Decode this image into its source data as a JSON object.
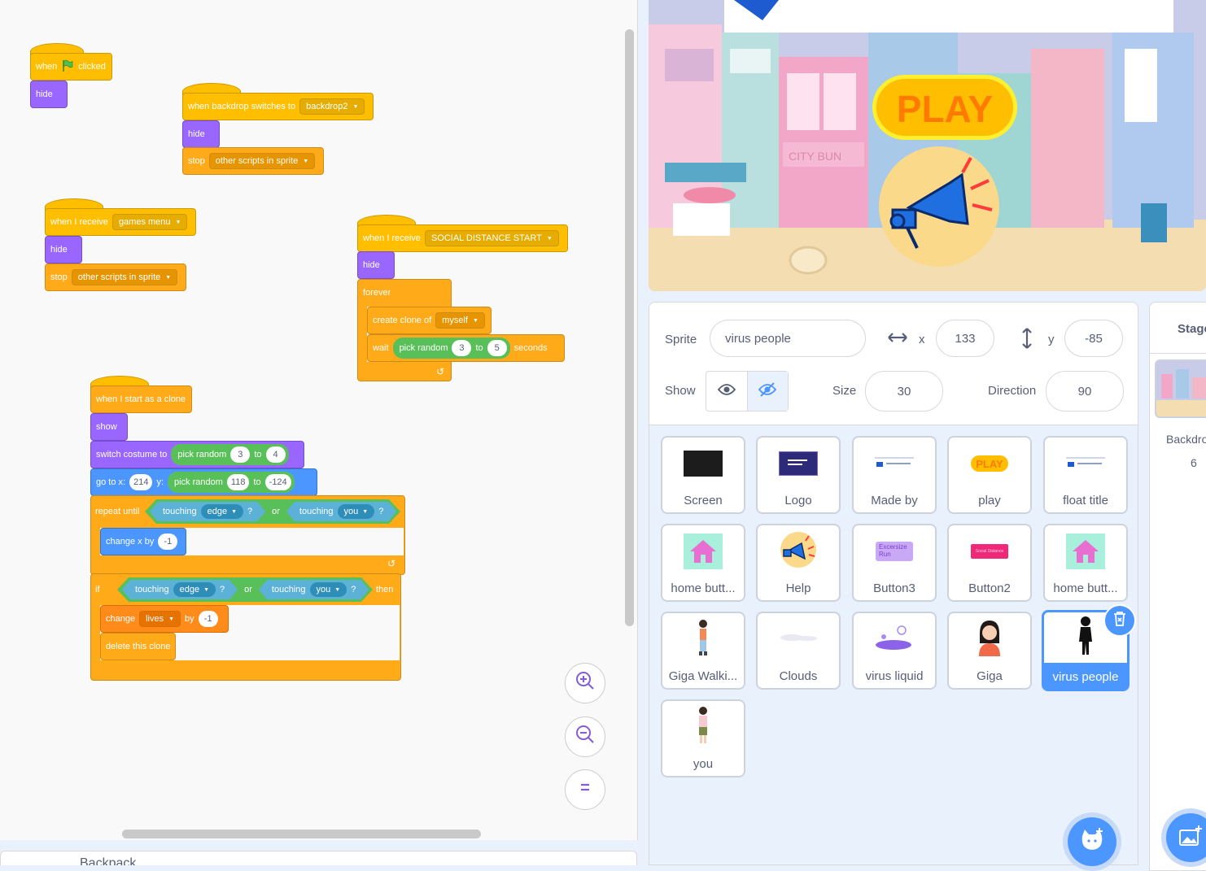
{
  "workspace": {
    "script1": {
      "when": "when",
      "clicked": "clicked",
      "hide": "hide"
    },
    "script2": {
      "label": "when backdrop switches to",
      "backdrop": "backdrop2",
      "hide": "hide",
      "stop": "stop",
      "stop_opt": "other scripts in sprite"
    },
    "script3": {
      "label": "when I receive",
      "msg": "games menu",
      "hide": "hide",
      "stop": "stop",
      "stop_opt": "other scripts in sprite"
    },
    "script4": {
      "label": "when I receive",
      "msg": "SOCIAL DISTANCE START",
      "hide": "hide",
      "forever": "forever",
      "create_clone": "create clone of",
      "clone_opt": "myself",
      "wait": "wait",
      "pick_random": "pick random",
      "from": "3",
      "to_label": "to",
      "to": "5",
      "seconds": "seconds"
    },
    "script5": {
      "label": "when I start as a clone",
      "show": "show",
      "switch_costume": "switch costume to",
      "pick_random": "pick random",
      "c_from": "3",
      "to_label": "to",
      "c_to": "4",
      "goto": "go to x:",
      "goto_x": "214",
      "y_label": "y:",
      "y_from": "118",
      "y_to": "-124",
      "repeat_until": "repeat until",
      "touching": "touching",
      "edge": "edge",
      "q": "?",
      "or": "or",
      "you": "you",
      "change_x": "change x by",
      "change_x_val": "-1",
      "if": "if",
      "then": "then",
      "change": "change",
      "lives": "lives",
      "by": "by",
      "lives_val": "-1",
      "delete_clone": "delete this clone"
    },
    "backpack": "Backpack"
  },
  "stage": {
    "play_label": "PLAY",
    "city_sign": "CITY BUN"
  },
  "sprite_info": {
    "sprite_label": "Sprite",
    "sprite_name": "virus people",
    "x_label": "x",
    "x": "133",
    "y_label": "y",
    "y": "-85",
    "show_label": "Show",
    "size_label": "Size",
    "size": "30",
    "direction_label": "Direction",
    "direction": "90"
  },
  "sprites": [
    {
      "name": "Screen"
    },
    {
      "name": "Logo"
    },
    {
      "name": "Made by"
    },
    {
      "name": "play"
    },
    {
      "name": "float title"
    },
    {
      "name": "home butt..."
    },
    {
      "name": "Help"
    },
    {
      "name": "Button3"
    },
    {
      "name": "Button2"
    },
    {
      "name": "home butt..."
    },
    {
      "name": "Giga Walki..."
    },
    {
      "name": "Clouds"
    },
    {
      "name": "virus liquid"
    },
    {
      "name": "Giga"
    },
    {
      "name": "virus people"
    },
    {
      "name": "you"
    }
  ],
  "thumb_text": {
    "play": "PLAY",
    "button3": "Excersize Run",
    "button2": "Social Distance"
  },
  "stage_panel": {
    "title": "Stage",
    "backdrops_label": "Backdro",
    "backdrops_count": "6"
  },
  "colors": {
    "events": "#ffbf00",
    "looks": "#9966ff",
    "control": "#ffab19",
    "operators": "#59c059",
    "motion": "#4c97ff",
    "variables": "#ff8c1a",
    "sensing": "#5cb1d6",
    "selected": "#4c97ff"
  }
}
